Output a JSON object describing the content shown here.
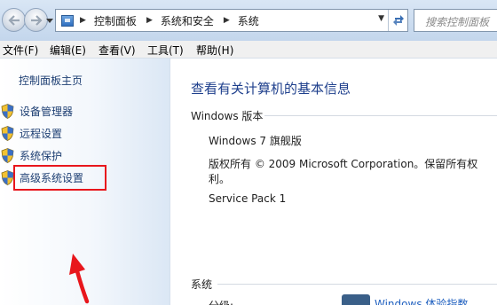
{
  "address_bar": {
    "breadcrumbs": [
      "控制面板",
      "系统和安全",
      "系统"
    ],
    "search_placeholder": "搜索控制面板"
  },
  "menu": [
    "文件(F)",
    "编辑(E)",
    "查看(V)",
    "工具(T)",
    "帮助(H)"
  ],
  "sidebar": {
    "home": "控制面板主页",
    "links": [
      "设备管理器",
      "远程设置",
      "系统保护",
      "高级系统设置"
    ]
  },
  "main": {
    "title": "查看有关计算机的基本信息",
    "edition_header": "Windows 版本",
    "edition": "Windows 7 旗舰版",
    "copyright_line1": "版权所有 © 2009 Microsoft Corporation。保留所有权",
    "copyright_line2": "利。",
    "service_pack": "Service Pack 1",
    "system_header": "系统",
    "rating_label": "分级:",
    "rating_link": "Windows 体验指数"
  },
  "colors": {
    "link": "#1e3f73",
    "title": "#1e3f8c",
    "highlight": "#e8161c"
  }
}
